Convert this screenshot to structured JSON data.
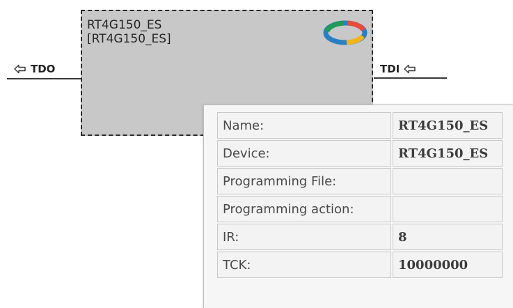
{
  "device": {
    "name": "RT4G150_ES",
    "id": "[RT4G150_ES]",
    "logo_icon": "microsemi-logo-icon",
    "fill_color": "#c8c8c8"
  },
  "ports": {
    "left": {
      "label": "TDO",
      "icon": "hollow-arrow-icon"
    },
    "right": {
      "label": "TDI",
      "icon": "hollow-arrow-icon"
    }
  },
  "tooltip": {
    "rows": [
      {
        "label": "Name:",
        "value": "RT4G150_ES"
      },
      {
        "label": "Device:",
        "value": "RT4G150_ES"
      },
      {
        "label": "Programming File:",
        "value": ""
      },
      {
        "label": "Programming action:",
        "value": ""
      },
      {
        "label": "IR:",
        "value": "8"
      },
      {
        "label": "TCK:",
        "value": "10000000"
      }
    ]
  }
}
